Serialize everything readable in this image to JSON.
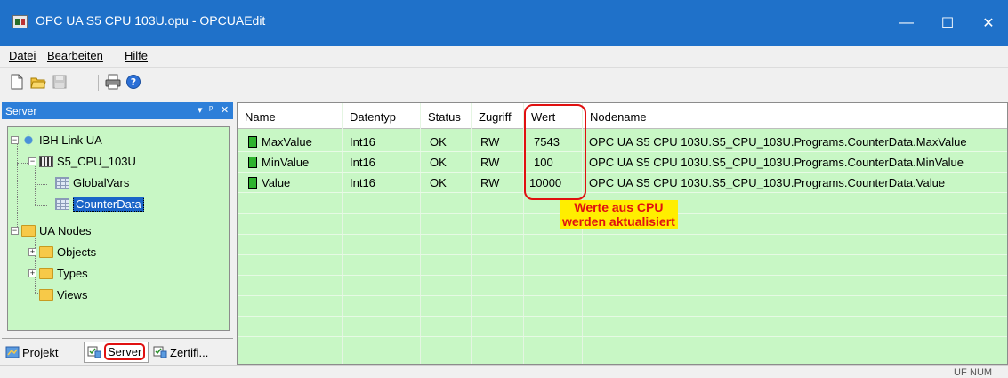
{
  "window": {
    "title": "OPC UA S5 CPU 103U.opu - OPCUAEdit",
    "minimize_glyph": "—",
    "maximize_glyph": "☐",
    "close_glyph": "✕"
  },
  "menu": {
    "items": [
      {
        "label": "Datei"
      },
      {
        "label": "Bearbeiten"
      },
      {
        "label": "Hilfe"
      }
    ]
  },
  "toolbar": {
    "icons": [
      "new-file-icon",
      "open-folder-icon",
      "save-icon",
      "print-icon",
      "help-icon"
    ]
  },
  "left_panel": {
    "title": "Server",
    "buttons": {
      "dropdown": "▾",
      "pin": "ᵖ",
      "close": "✕"
    },
    "tree": [
      {
        "label": "IBH Link UA",
        "icon": "network-icon",
        "expanded": true
      },
      {
        "label": "S5_CPU_103U",
        "icon": "cpu-icon",
        "expanded": true
      },
      {
        "label": "GlobalVars",
        "icon": "grid-icon"
      },
      {
        "label": "CounterData",
        "icon": "grid-icon",
        "selected": true
      },
      {
        "label": "UA Nodes",
        "icon": "folder-icon",
        "expanded": true
      },
      {
        "label": "Objects",
        "icon": "folder-icon",
        "expanded": false
      },
      {
        "label": "Types",
        "icon": "folder-icon",
        "expanded": false
      },
      {
        "label": "Views",
        "icon": "folder-icon"
      }
    ],
    "tabs": [
      {
        "label": "Projekt"
      },
      {
        "label": "Server",
        "active": true
      },
      {
        "label": "Zertifi..."
      }
    ]
  },
  "grid": {
    "columns": [
      "Name",
      "Datentyp",
      "Status",
      "Zugriff",
      "Wert",
      "Nodename"
    ],
    "rows": [
      {
        "name": "MaxValue",
        "type": "Int16",
        "status": "OK",
        "access": "RW",
        "value": "7543",
        "nodename": "OPC UA S5 CPU 103U.S5_CPU_103U.Programs.CounterData.MaxValue"
      },
      {
        "name": "MinValue",
        "type": "Int16",
        "status": "OK",
        "access": "RW",
        "value": "100",
        "nodename": "OPC UA S5 CPU 103U.S5_CPU_103U.Programs.CounterData.MinValue"
      },
      {
        "name": "Value",
        "type": "Int16",
        "status": "OK",
        "access": "RW",
        "value": "10000",
        "nodename": "OPC UA S5 CPU 103U.S5_CPU_103U.Programs.CounterData.Value"
      }
    ]
  },
  "annotation": {
    "line1": "Werte aus CPU",
    "line2": "werden aktualisiert",
    "text_color": "#e01010",
    "background": "#ffee00"
  },
  "statusbar": {
    "indicator1": "UF",
    "indicator2": "NUM"
  },
  "colors": {
    "titlebar": "#1f71c9",
    "panel_header": "#2d7fd9",
    "content_background": "#c8f7c5",
    "highlight_red": "#e01010"
  }
}
